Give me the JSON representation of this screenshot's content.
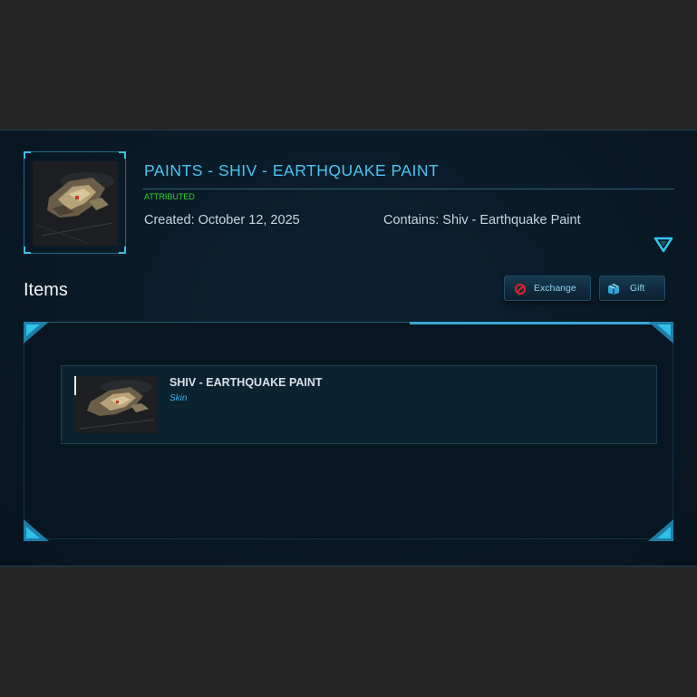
{
  "pledge": {
    "title": "PAINTS - SHIV - EARTHQUAKE PAINT",
    "status": "ATTRIBUTED",
    "created": "Created: October 12, 2025",
    "contains": "Contains: Shiv - Earthquake Paint",
    "expand_icon": "chevron-down-triangle-icon"
  },
  "items_section": {
    "heading": "Items",
    "buttons": [
      {
        "label": "Exchange",
        "icon": "exchange-no-icon"
      },
      {
        "label": "Gift",
        "icon": "gift-box-icon"
      }
    ],
    "items": [
      {
        "name": "SHIV - EARTHQUAKE PAINT",
        "type": "Skin"
      }
    ]
  },
  "colors": {
    "accent": "#4cc4f0",
    "status": "#2ed42e",
    "background": "#252526",
    "panel": "#0a1a28"
  }
}
